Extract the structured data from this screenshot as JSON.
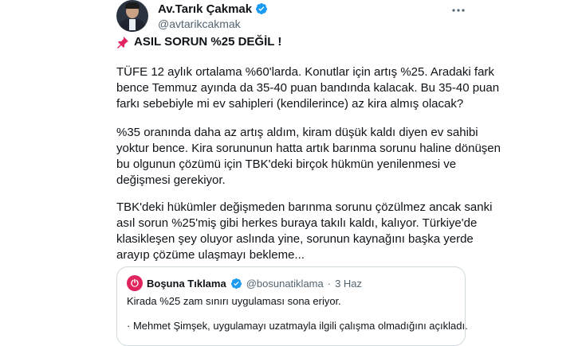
{
  "author": {
    "name": "Av.Tarık Çakmak",
    "handle": "@avtarikcakmak"
  },
  "headline": "ASIL SORUN %25 DEĞİL !",
  "paragraphs": [
    [
      "TÜFE 12 aylık ortalama %60'larda. Konutlar için artış %25. Aradaki fark",
      "bence Temmuz ayında da 35-40 puan bandında kalacak. Bu 35-40 puan",
      "farkı sebebiyle mi ev sahipleri (kendilerince) az kira almış olacak?"
    ],
    [
      "%35 oranında daha az artış aldım, kiram düşük kaldı diyen ev sahibi",
      "yoktur bence. Kira sorununun hatta artık barınma sorunu haline dönüşen",
      "bu olgunun çözümü için TBK'deki birçok hükmün  yenilenmesi ve",
      "değişmesi gerekiyor."
    ],
    [
      "TBK'deki hükümler değişmeden barınma sorunu çözülmez ancak sanki",
      "asıl sorun %25'miş gibi herkes buraya takılı kaldı, kalıyor. Türkiye'de",
      "klasikleşen şey oluyor aslında yine, sorunun kaynağını başka yerde",
      "arayıp çözüme ulaşmayı bekleme..."
    ]
  ],
  "quote": {
    "name": "Boşuna Tıklama",
    "handle": "@bosunatiklama",
    "separator": "·",
    "date": "3 Haz",
    "line1": "Kirada %25 zam sınırı uygulaması sona eriyor.",
    "line2": "· Mehmet Şimşek, uygulamayı uzatmayla ilgili çalışma olmadığını açıkladı."
  },
  "icons": {
    "verified": "verified-badge-icon",
    "pin": "pushpin-icon",
    "more": "more-options-icon",
    "accent": "#1d9bf0",
    "pin_color": "#e0245e"
  }
}
